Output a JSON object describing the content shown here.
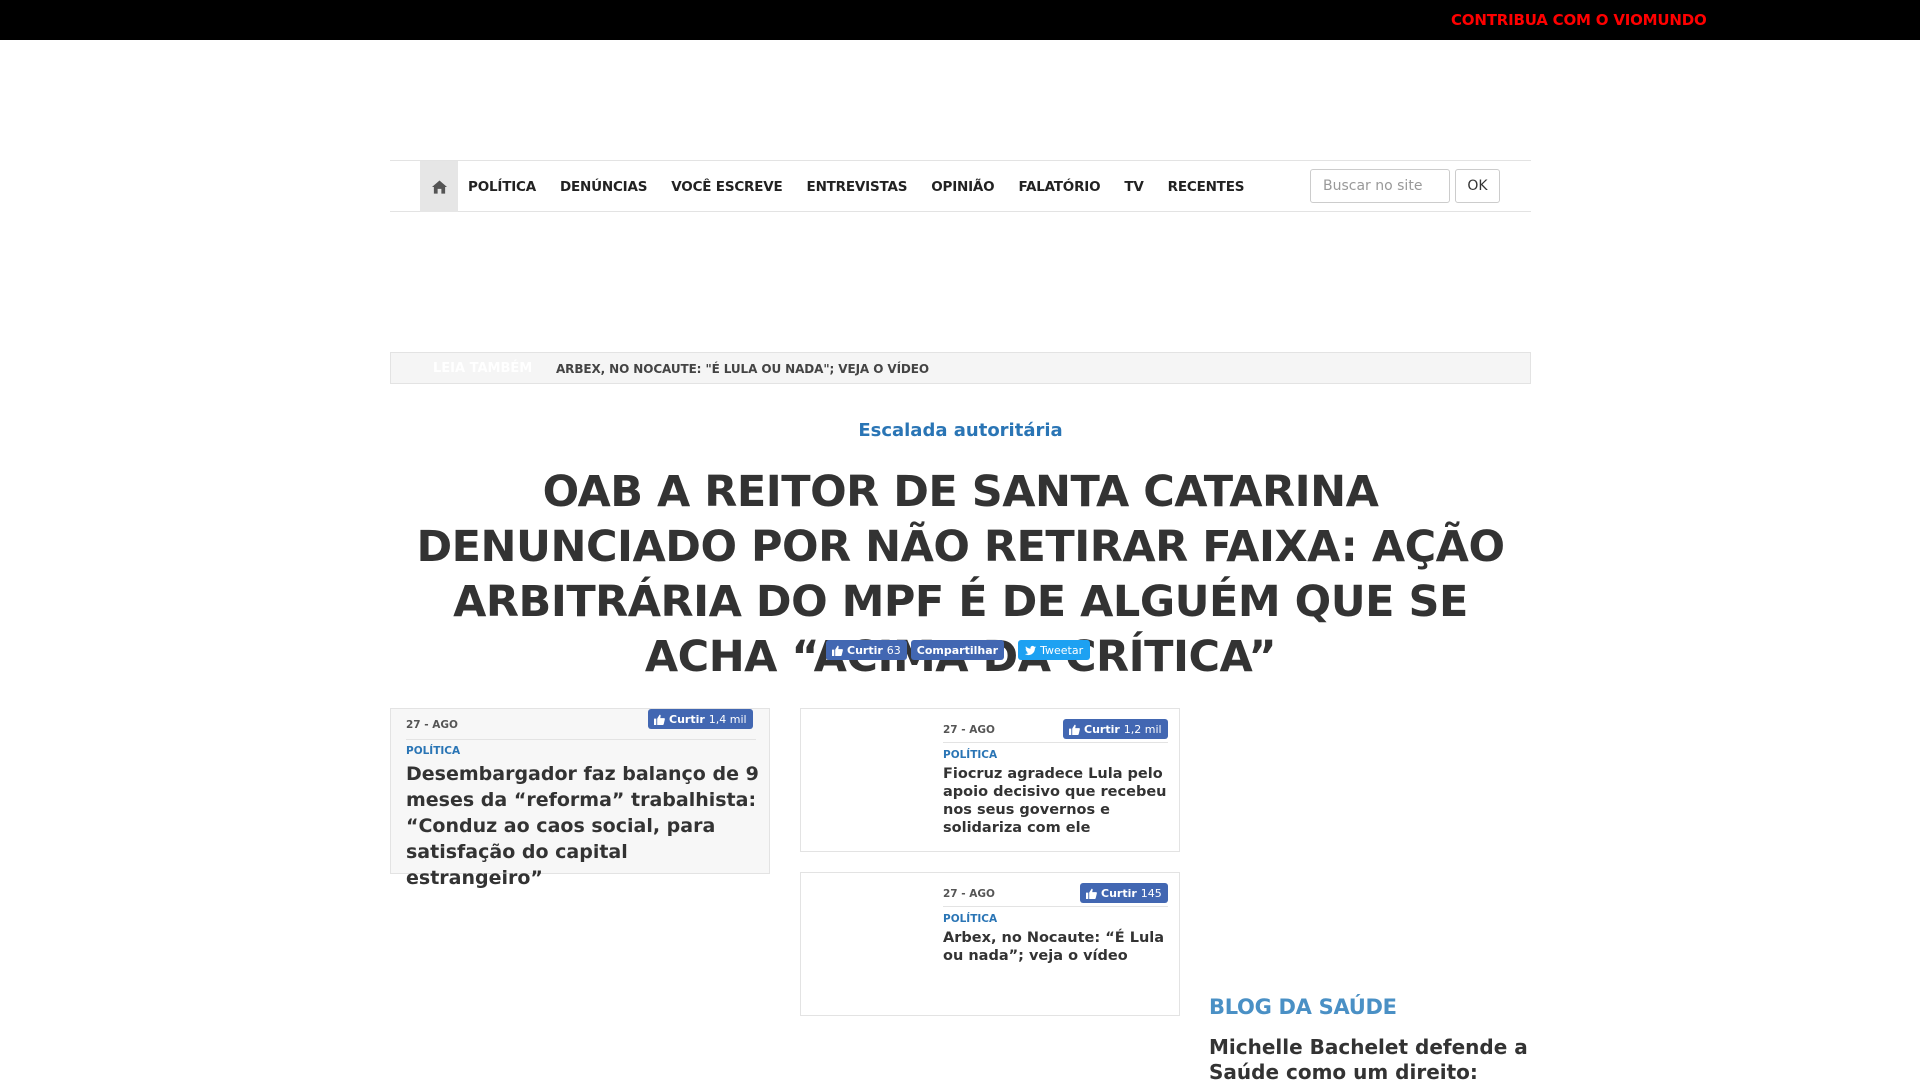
{
  "topbar": {
    "contribute_label": "CONTRIBUA COM O VIOMUNDO",
    "contribute_color": "#ff0000"
  },
  "nav": {
    "home_icon": "home-icon",
    "items": [
      "POLÍTICA",
      "DENÚNCIAS",
      "VOCÊ ESCREVE",
      "ENTREVISTAS",
      "OPINIÃO",
      "FALATÓRIO",
      "TV",
      "RECENTES"
    ],
    "search_placeholder": "Buscar no site",
    "search_button": "OK"
  },
  "leia_tambem": {
    "label": "LEIA TAMBÉM",
    "headline": "ARBEX, NO NOCAUTE: \"É LULA OU NADA\"; VEJA O VÍDEO"
  },
  "article": {
    "kicker": "Escalada autoritária",
    "title": "OAB A REITOR DE SANTA CATARINA DENUNCIADO POR NÃO RETIRAR FAIXA: AÇÃO ARBITRÁRIA DO MPF É DE ALGUÉM QUE SE ACHA “ACIMA DA CRÍTICA”",
    "share": {
      "like_label": "Curtir",
      "like_count": "63",
      "share_label": "Compartilhar",
      "tweet_label": "Tweetar"
    }
  },
  "cards": [
    {
      "date": "27 - AGO",
      "category": "POLÍTICA",
      "like_label": "Curtir",
      "like_count": "1,4 mil",
      "title": "Desembargador faz balanço de 9 meses da “reforma” trabalhista: “Conduz ao caos social, para satisfação do capital estrangeiro”"
    },
    {
      "date": "27 - AGO",
      "category": "POLÍTICA",
      "like_label": "Curtir",
      "like_count": "1,2 mil",
      "title": "Fiocruz agradece Lula pelo apoio decisivo que recebeu nos seus governos e solidariza com ele"
    },
    {
      "date": "27 - AGO",
      "category": "POLÍTICA",
      "like_label": "Curtir",
      "like_count": "145",
      "title": "Arbex, no Nocaute: “É Lula ou nada”; veja o vídeo"
    }
  ],
  "sidebar": {
    "blog_title": "BLOG DA SAÚDE",
    "blog_article": "Michelle Bachelet defende a Saúde como um direito:"
  },
  "colors": {
    "accent": "#2a75b5",
    "facebook": "#4267b2",
    "twitter": "#1da1f2",
    "blog": "#4a90c5"
  }
}
